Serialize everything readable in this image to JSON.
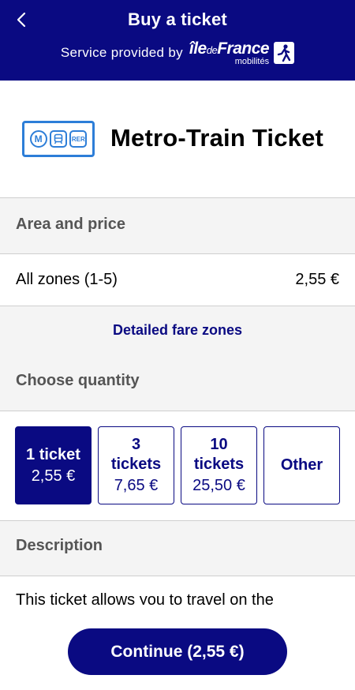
{
  "header": {
    "title": "Buy a ticket",
    "provider_text": "Service provided by",
    "logo_main_prefix": "île",
    "logo_main_de": "de",
    "logo_main_suffix": "France",
    "logo_sub": "mobilités"
  },
  "product": {
    "title": "Metro-Train Ticket",
    "icon_labels": [
      "M",
      "RER"
    ]
  },
  "area": {
    "label": "Area and price",
    "zone_name": "All zones (1-5)",
    "zone_price": "2,55 €",
    "link_label": "Detailed fare zones"
  },
  "quantity": {
    "label": "Choose quantity",
    "options": [
      {
        "label": "1 ticket",
        "price": "2,55 €",
        "selected": true
      },
      {
        "label": "3 tickets",
        "price": "7,65 €",
        "selected": false
      },
      {
        "label": "10 tickets",
        "price": "25,50 €",
        "selected": false
      },
      {
        "label": "Other",
        "price": "",
        "selected": false
      }
    ]
  },
  "description": {
    "label": "Description",
    "text": "This ticket allows you to travel on the"
  },
  "footer": {
    "continue_label": "Continue (2,55 €)"
  },
  "colors": {
    "brand": "#0a0a82",
    "icon_blue": "#2d7ed8"
  }
}
